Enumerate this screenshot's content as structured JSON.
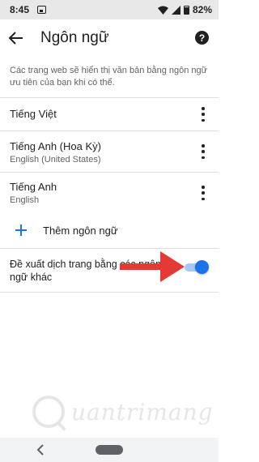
{
  "status_bar": {
    "time": "8:45",
    "battery_percent": "82%"
  },
  "header": {
    "title": "Ngôn ngữ",
    "back_icon": "arrow-back-icon",
    "help_icon": "help-icon",
    "help_glyph": "?"
  },
  "description": "Các trang web sẽ hiển thị văn bản bằng ngôn ngữ ưu tiên của bạn khi có thể.",
  "languages": [
    {
      "name": "Tiếng Việt",
      "subtitle": ""
    },
    {
      "name": "Tiếng Anh (Hoa Kỳ)",
      "subtitle": "English (United States)"
    },
    {
      "name": "Tiếng Anh",
      "subtitle": "English"
    }
  ],
  "add_language": {
    "label": "Thêm ngôn ngữ"
  },
  "offer_translate": {
    "label": "Đề xuất dịch trang bằng các ngôn ngữ khác",
    "enabled": true
  },
  "annotation": {
    "arrow_color": "#e53935"
  },
  "watermark": {
    "text": "uantrimang"
  },
  "colors": {
    "accent": "#1a73e8",
    "toggle_track": "#a8c7fa"
  }
}
